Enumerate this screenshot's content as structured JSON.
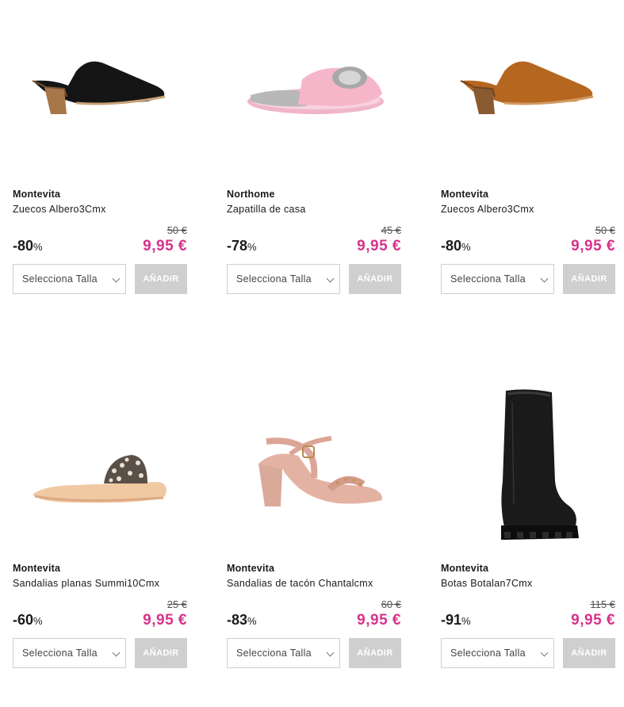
{
  "products": [
    {
      "brand": "Montevita",
      "name": "Zuecos Albero3Cmx",
      "old_price": "50 €",
      "discount": "-80",
      "pct": "%",
      "price": "9,95 €",
      "select_label": "Selecciona Talla",
      "add_label": "AÑADIR",
      "image_icon": "black-mule-shoe-icon"
    },
    {
      "brand": "Northome",
      "name": "Zapatilla de casa",
      "old_price": "45 €",
      "discount": "-78",
      "pct": "%",
      "price": "9,95 €",
      "select_label": "Selecciona Talla",
      "add_label": "AÑADIR",
      "image_icon": "pink-slipper-icon"
    },
    {
      "brand": "Montevita",
      "name": "Zuecos Albero3Cmx",
      "old_price": "50 €",
      "discount": "-80",
      "pct": "%",
      "price": "9,95 €",
      "select_label": "Selecciona Talla",
      "add_label": "AÑADIR",
      "image_icon": "tan-mule-shoe-icon"
    },
    {
      "brand": "Montevita",
      "name": "Sandalias planas Summi10Cmx",
      "old_price": "25 €",
      "discount": "-60",
      "pct": "%",
      "price": "9,95 €",
      "select_label": "Selecciona Talla",
      "add_label": "AÑADIR",
      "image_icon": "flat-sandal-icon"
    },
    {
      "brand": "Montevita",
      "name": "Sandalias de tacón Chantalcmx",
      "old_price": "60 €",
      "discount": "-83",
      "pct": "%",
      "price": "9,95 €",
      "select_label": "Selecciona Talla",
      "add_label": "AÑADIR",
      "image_icon": "heel-sandal-icon"
    },
    {
      "brand": "Montevita",
      "name": "Botas Botalan7Cmx",
      "old_price": "115 €",
      "discount": "-91",
      "pct": "%",
      "price": "9,95 €",
      "select_label": "Selecciona Talla",
      "add_label": "AÑADIR",
      "image_icon": "black-boot-icon"
    }
  ],
  "colors": {
    "sale_price": "#d6338a",
    "button_disabled": "#cfcfcf"
  }
}
